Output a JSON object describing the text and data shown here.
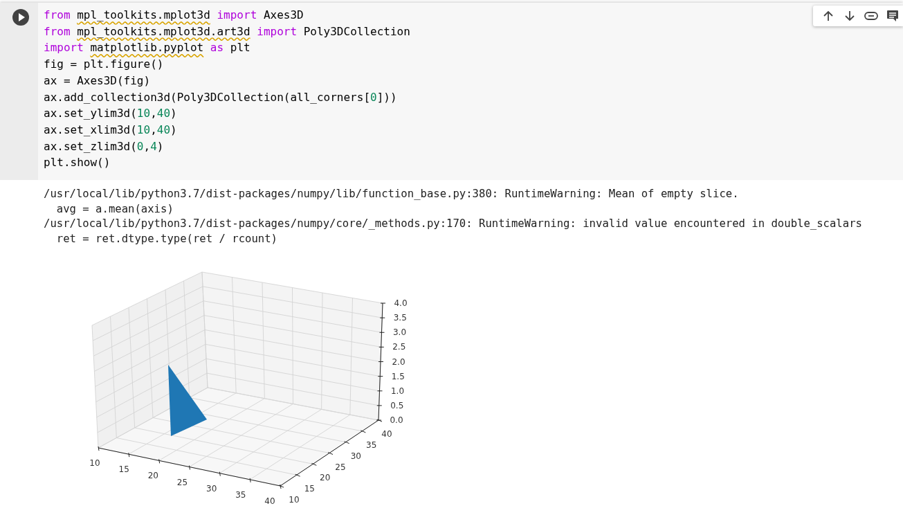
{
  "cell": {
    "code_lines": [
      [
        {
          "text": "from ",
          "kind": "keyword"
        },
        {
          "text": "mpl_toolkits.mplot3d",
          "kind": "flagged"
        },
        {
          "text": " import",
          "kind": "keyword"
        },
        {
          "text": " Axes3D",
          "kind": "plain"
        }
      ],
      [
        {
          "text": "from ",
          "kind": "keyword"
        },
        {
          "text": "mpl_toolkits.mplot3d.art3d",
          "kind": "flagged"
        },
        {
          "text": " import",
          "kind": "keyword"
        },
        {
          "text": " Poly3DCollection",
          "kind": "plain"
        }
      ],
      [
        {
          "text": "import ",
          "kind": "keyword"
        },
        {
          "text": "matplotlib.pyplot",
          "kind": "flagged"
        },
        {
          "text": " as",
          "kind": "keyword"
        },
        {
          "text": " plt",
          "kind": "plain"
        }
      ],
      [
        {
          "text": "fig = plt.figure()",
          "kind": "plain"
        }
      ],
      [
        {
          "text": "ax = Axes3D(fig)",
          "kind": "plain"
        }
      ],
      [
        {
          "text": "ax.add_collection3d(Poly3DCollection(all_corners[",
          "kind": "plain"
        },
        {
          "text": "0",
          "kind": "number"
        },
        {
          "text": "]))",
          "kind": "plain"
        }
      ],
      [
        {
          "text": "ax.set_ylim3d(",
          "kind": "plain"
        },
        {
          "text": "10",
          "kind": "number"
        },
        {
          "text": ",",
          "kind": "plain"
        },
        {
          "text": "40",
          "kind": "number"
        },
        {
          "text": ")",
          "kind": "plain"
        }
      ],
      [
        {
          "text": "ax.set_xlim3d(",
          "kind": "plain"
        },
        {
          "text": "10",
          "kind": "number"
        },
        {
          "text": ",",
          "kind": "plain"
        },
        {
          "text": "40",
          "kind": "number"
        },
        {
          "text": ")",
          "kind": "plain"
        }
      ],
      [
        {
          "text": "ax.set_zlim3d(",
          "kind": "plain"
        },
        {
          "text": "0",
          "kind": "number"
        },
        {
          "text": ",",
          "kind": "plain"
        },
        {
          "text": "4",
          "kind": "number"
        },
        {
          "text": ")",
          "kind": "plain"
        }
      ],
      [
        {
          "text": "plt.show()",
          "kind": "plain"
        }
      ]
    ],
    "output_lines": [
      "/usr/local/lib/python3.7/dist-packages/numpy/lib/function_base.py:380: RuntimeWarning: Mean of empty slice.",
      "  avg = a.mean(axis)",
      "/usr/local/lib/python3.7/dist-packages/numpy/core/_methods.py:170: RuntimeWarning: invalid value encountered in double_scalars",
      "  ret = ret.dtype.type(ret / rcount)"
    ],
    "plot": {
      "x_ticks": [
        "10",
        "15",
        "20",
        "25",
        "30",
        "35",
        "40"
      ],
      "y_ticks": [
        "10",
        "15",
        "20",
        "25",
        "30",
        "35",
        "40"
      ],
      "z_ticks": [
        "4.0",
        "3.5",
        "3.0",
        "2.5",
        "2.0",
        "1.5",
        "1.0",
        "0.5",
        "0.0"
      ]
    }
  }
}
